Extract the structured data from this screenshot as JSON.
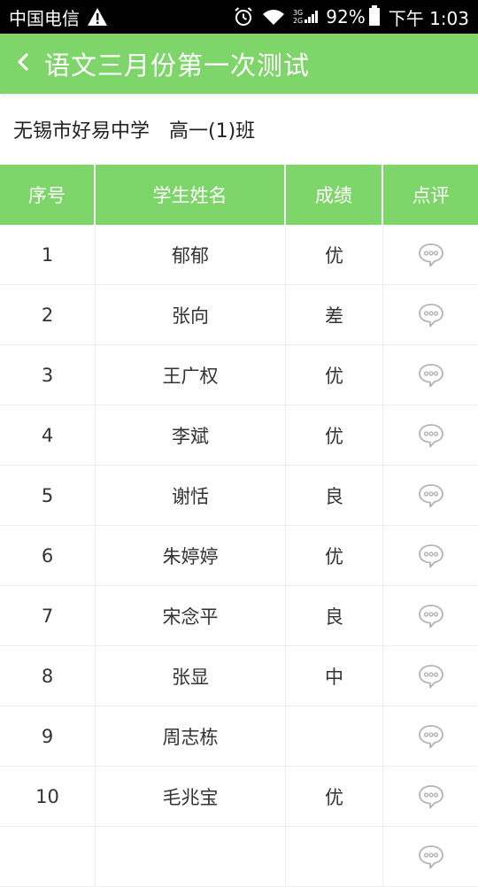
{
  "status_bar": {
    "carrier": "中国电信",
    "network_top": "3G",
    "network_bottom": "2G",
    "battery": "92%",
    "time": "下午 1:03"
  },
  "header": {
    "title": "语文三月份第一次测试"
  },
  "info": {
    "school": "无锡市好易中学",
    "class": "高一(1)班"
  },
  "table": {
    "headers": [
      "序号",
      "学生姓名",
      "成绩",
      "点评"
    ],
    "rows": [
      {
        "no": "1",
        "name": "郁郁",
        "grade": "优"
      },
      {
        "no": "2",
        "name": "张向",
        "grade": "差"
      },
      {
        "no": "3",
        "name": "王广权",
        "grade": "优"
      },
      {
        "no": "4",
        "name": "李斌",
        "grade": "优"
      },
      {
        "no": "5",
        "name": "谢恬",
        "grade": "良"
      },
      {
        "no": "6",
        "name": "朱婷婷",
        "grade": "优"
      },
      {
        "no": "7",
        "name": "宋念平",
        "grade": "良"
      },
      {
        "no": "8",
        "name": "张显",
        "grade": "中"
      },
      {
        "no": "9",
        "name": "周志栋",
        "grade": ""
      },
      {
        "no": "10",
        "name": "毛兆宝",
        "grade": "优"
      },
      {
        "no": "",
        "name": "",
        "grade": ""
      }
    ]
  },
  "colors": {
    "accent": "#7ed56a",
    "status_bar": "#000000",
    "divider": "#ececec"
  },
  "icons": {
    "back": "chevron-left-icon",
    "comment": "speech-bubble-icon",
    "alarm": "alarm-clock-icon",
    "wifi": "wifi-icon",
    "warning": "warning-icon"
  }
}
